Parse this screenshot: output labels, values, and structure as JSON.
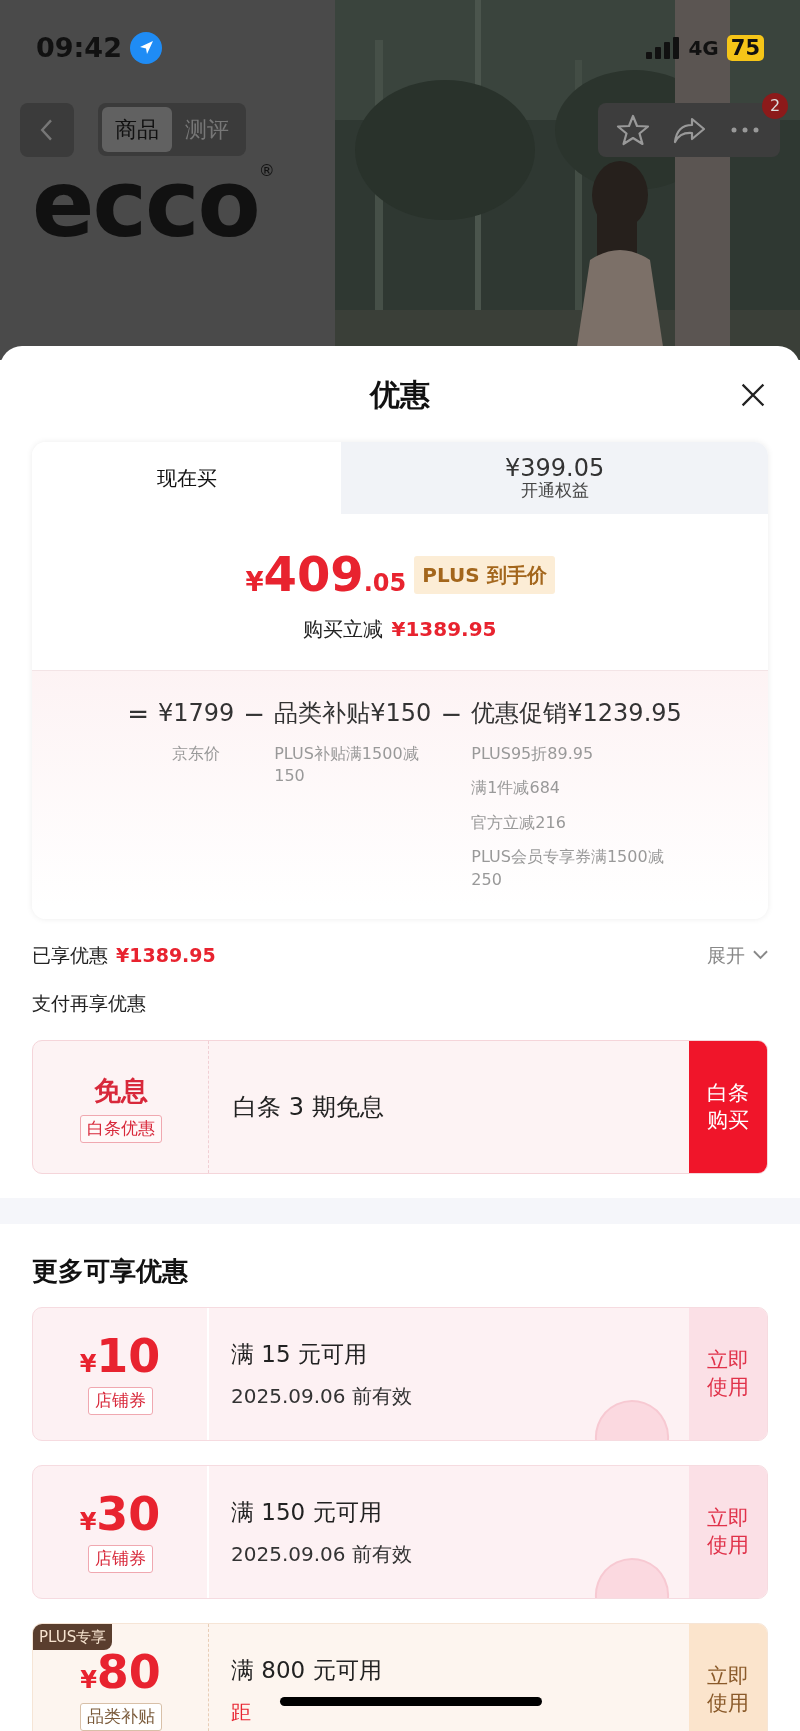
{
  "status_bar": {
    "time": "09:42",
    "network": "4G",
    "battery": "75"
  },
  "nav": {
    "tabs": [
      {
        "label": "商品",
        "selected": true
      },
      {
        "label": "测评",
        "selected": false
      }
    ],
    "badge": "2"
  },
  "brand": {
    "logo": "ecco",
    "mark": "®"
  },
  "sheet": {
    "title": "优惠"
  },
  "price_tabs": [
    {
      "label": "现在买",
      "selected": true
    },
    {
      "price": "¥399.05",
      "label": "开通权益",
      "selected": false
    }
  ],
  "final_price": {
    "currency": "¥",
    "integer": "409",
    "decimal": ".05",
    "tag": "PLUS 到手价"
  },
  "reduction": {
    "label": "购买立减",
    "amount": "¥1389.95"
  },
  "breakdown": [
    {
      "operator": "=",
      "amount": "¥1799",
      "notes": [
        "京东价"
      ]
    },
    {
      "operator": "−",
      "label": "品类补贴",
      "amount": "¥150",
      "notes": [
        "PLUS补贴满1500减150"
      ]
    },
    {
      "operator": "−",
      "label": "优惠促销",
      "amount": "¥1239.95",
      "notes": [
        "PLUS95折89.95",
        "满1件减684",
        "官方立减216",
        "PLUS会员专享券满1500减250"
      ]
    }
  ],
  "enjoyed": {
    "label": "已享优惠",
    "amount": "¥1389.95",
    "toggle": "展开"
  },
  "pay_heading": "支付再享优惠",
  "pay_offer": {
    "title": "免息",
    "tag": "白条优惠",
    "text": "白条 3 期免息",
    "action": "白条购买"
  },
  "more_heading": "更多可享优惠",
  "coupons": [
    {
      "kind": "store",
      "currency": "¥",
      "amount": "10",
      "tag": "店铺券",
      "condition": "满 15 元可用",
      "validity": "2025.09.06 前有效",
      "action": "立即使用",
      "claimed": true
    },
    {
      "kind": "store",
      "currency": "¥",
      "amount": "30",
      "tag": "店铺券",
      "condition": "满 150 元可用",
      "validity": "2025.09.06 前有效",
      "action": "立即使用",
      "claimed": true
    },
    {
      "kind": "plus",
      "badge": "PLUS专享",
      "currency": "¥",
      "amount": "80",
      "tag": "品类补贴",
      "condition": "满 800 元可用",
      "validity": "距",
      "action": "立即使用",
      "claimed": false
    }
  ]
}
